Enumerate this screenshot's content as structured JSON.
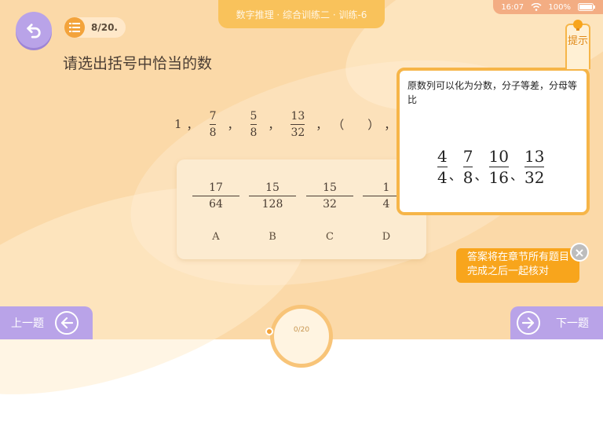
{
  "header": {
    "title": "数字推理 · 综合训练二 · 训练-6",
    "counter": "8/20."
  },
  "status_bar": {
    "time": "16:07",
    "battery": "100%"
  },
  "question": {
    "prompt": "请选出括号中恰当的数",
    "sequence_first": "1",
    "sequence_fracs": [
      {
        "num": "7",
        "den": "8"
      },
      {
        "num": "5",
        "den": "8"
      },
      {
        "num": "13",
        "den": "32"
      }
    ],
    "separator": "，",
    "blank": "（　　）"
  },
  "options": [
    {
      "num": "17",
      "den": "64",
      "letter": "A"
    },
    {
      "num": "15",
      "den": "128",
      "letter": "B"
    },
    {
      "num": "15",
      "den": "32",
      "letter": "C"
    },
    {
      "num": "1",
      "den": "4",
      "letter": "D"
    }
  ],
  "hint": {
    "tab_label": "提示",
    "text": "原数列可以化为分数，分子等差，分母等比",
    "fracs": [
      {
        "num": "4",
        "den": "4"
      },
      {
        "num": "7",
        "den": "8"
      },
      {
        "num": "10",
        "den": "16"
      },
      {
        "num": "13",
        "den": "32"
      }
    ],
    "separator": "、"
  },
  "notice": "答案将在章节所有题目完成之后一起核对",
  "nav": {
    "prev_label": "上一题",
    "next_label": "下一题",
    "progress": "0/20"
  },
  "colors": {
    "background": "#fbd9a8",
    "accent_orange": "#f8a51c",
    "purple": "#b9a3e8"
  }
}
